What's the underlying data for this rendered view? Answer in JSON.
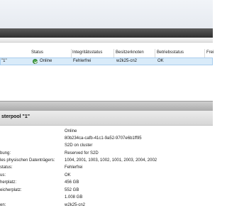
{
  "list": {
    "columns": [
      "Status",
      "Integritätsstatus",
      "Besitzerknoten",
      "Betriebsstatus",
      "Frei"
    ],
    "row": {
      "name": "\"1\"",
      "status": "Online",
      "integrity": "Fehlerfrei",
      "owner": "w2k25-cn2",
      "operational": "OK",
      "status_icon": "ok-status-icon"
    }
  },
  "details": {
    "title": "sterpool \"1\"",
    "properties": [
      {
        "label": "",
        "value": "Online"
      },
      {
        "label": "",
        "value": "80b234ca-cafb-41c1-9a52-9707e6b1ff95"
      },
      {
        "label": "",
        "value": "S2D on cluster"
      },
      {
        "label": "bung:",
        "value": "Reserved for S2D"
      },
      {
        "label": "les physischen Datenträgers:",
        "value": "1004, 2001, 1003, 1002, 1001, 2003, 2004, 2002"
      },
      {
        "label": "status:",
        "value": "Fehlerfrei"
      },
      {
        "label": "us:",
        "value": "OK"
      },
      {
        "label": "herplatz:",
        "value": "456 GB"
      },
      {
        "label": "eicherplatz:",
        "value": "552 GB"
      },
      {
        "label": "",
        "value": "1.008 GB"
      },
      {
        "label": "en:",
        "value": "w2k25-cn2"
      }
    ]
  },
  "colors": {
    "selection": "#d9ebf9",
    "ok_icon": "#4fa64f"
  }
}
